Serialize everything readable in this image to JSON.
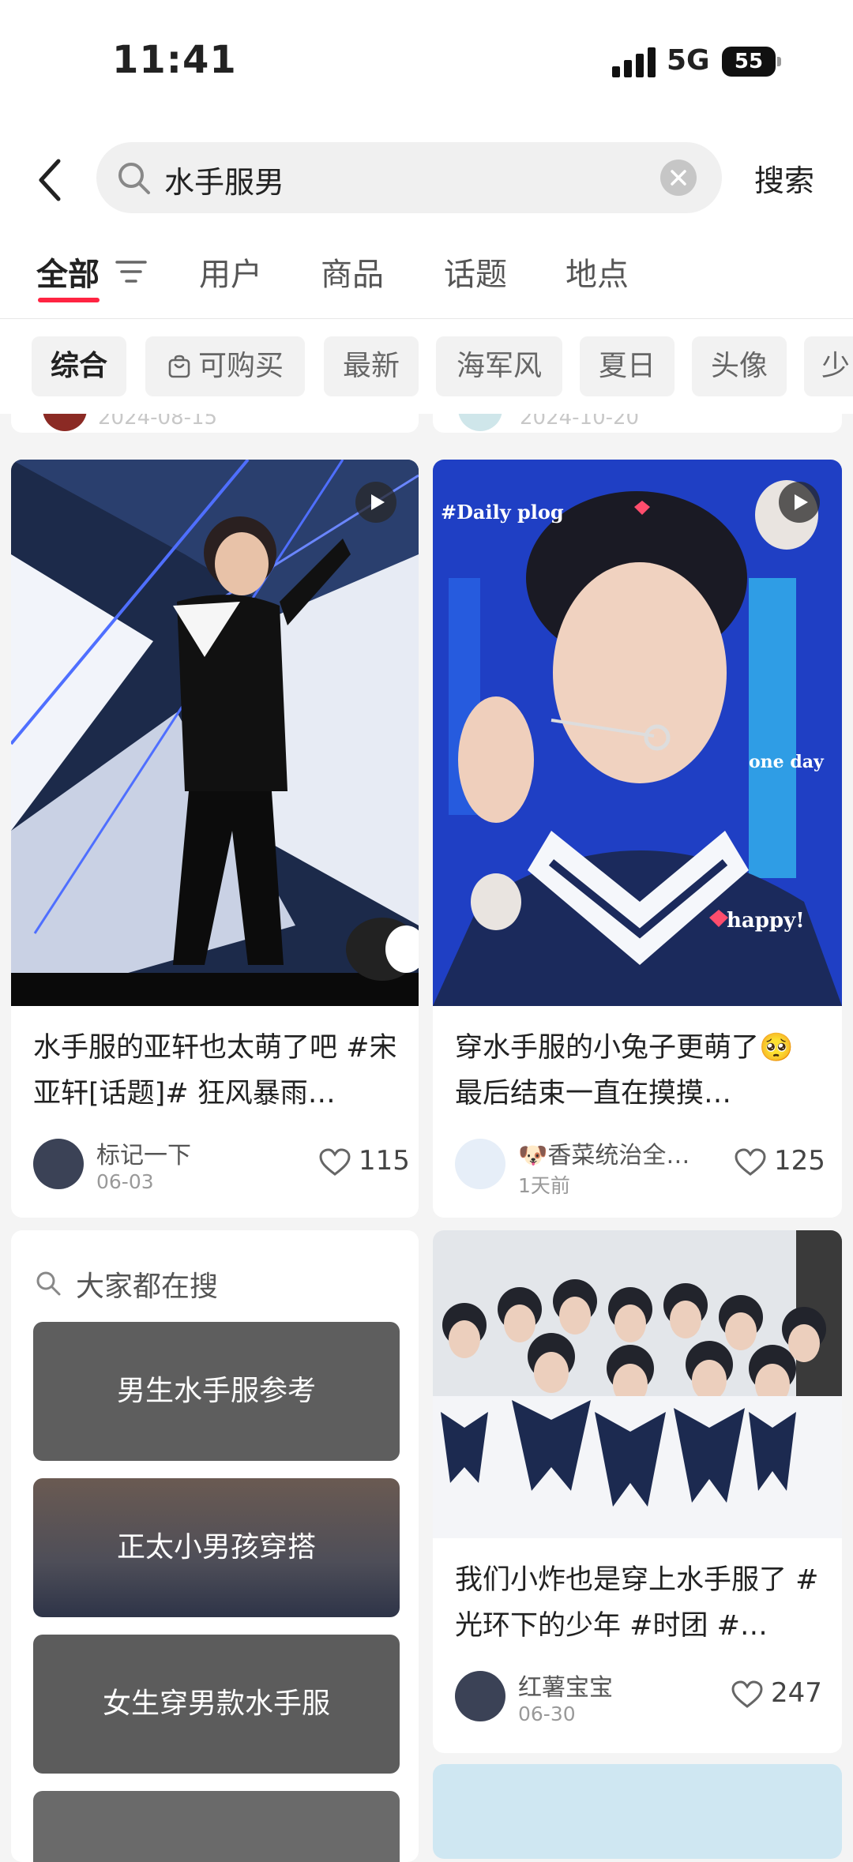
{
  "status_bar": {
    "time": "11:41",
    "network": "5G",
    "battery": "55"
  },
  "search": {
    "query": "水手服男",
    "button": "搜索"
  },
  "tabs": [
    {
      "label": "全部",
      "active": true
    },
    {
      "label": "用户"
    },
    {
      "label": "商品"
    },
    {
      "label": "话题"
    },
    {
      "label": "地点"
    }
  ],
  "chips": [
    "综合",
    "可购买",
    "最新",
    "海军风",
    "夏日",
    "头像",
    "少"
  ],
  "peek_dates": [
    "2024-08-15",
    "2024-10-20"
  ],
  "posts": [
    {
      "title": "水手服的亚轩也太萌了吧 #宋亚轩[话题]# 狂风暴雨…",
      "author": "标记一下",
      "date": "06-03",
      "likes": "115",
      "image_desc": "stage performer in black sailor outfit",
      "video": true
    },
    {
      "title": "穿水手服的小兔子更萌了🥺 最后结束一直在摸摸…",
      "author": "🐶香菜统治全…",
      "date": "1天前",
      "likes": "125",
      "image_labels": [
        "#Daily plog",
        "one day",
        "happy!"
      ],
      "video": true
    },
    {
      "title": "我们小炸也是穿上水手服了 #光环下的少年 #时团 #…",
      "author": "红薯宝宝",
      "date": "06-30",
      "likes": "247",
      "video": false
    }
  ],
  "trending": {
    "header": "大家都在搜",
    "items": [
      "男生水手服参考",
      "正太小男孩穿搭",
      "女生穿男款水手服"
    ]
  },
  "colors": {
    "accent": "#ff2442",
    "chip_bg": "#f2f2f2",
    "page_bg": "#f4f4f4"
  }
}
